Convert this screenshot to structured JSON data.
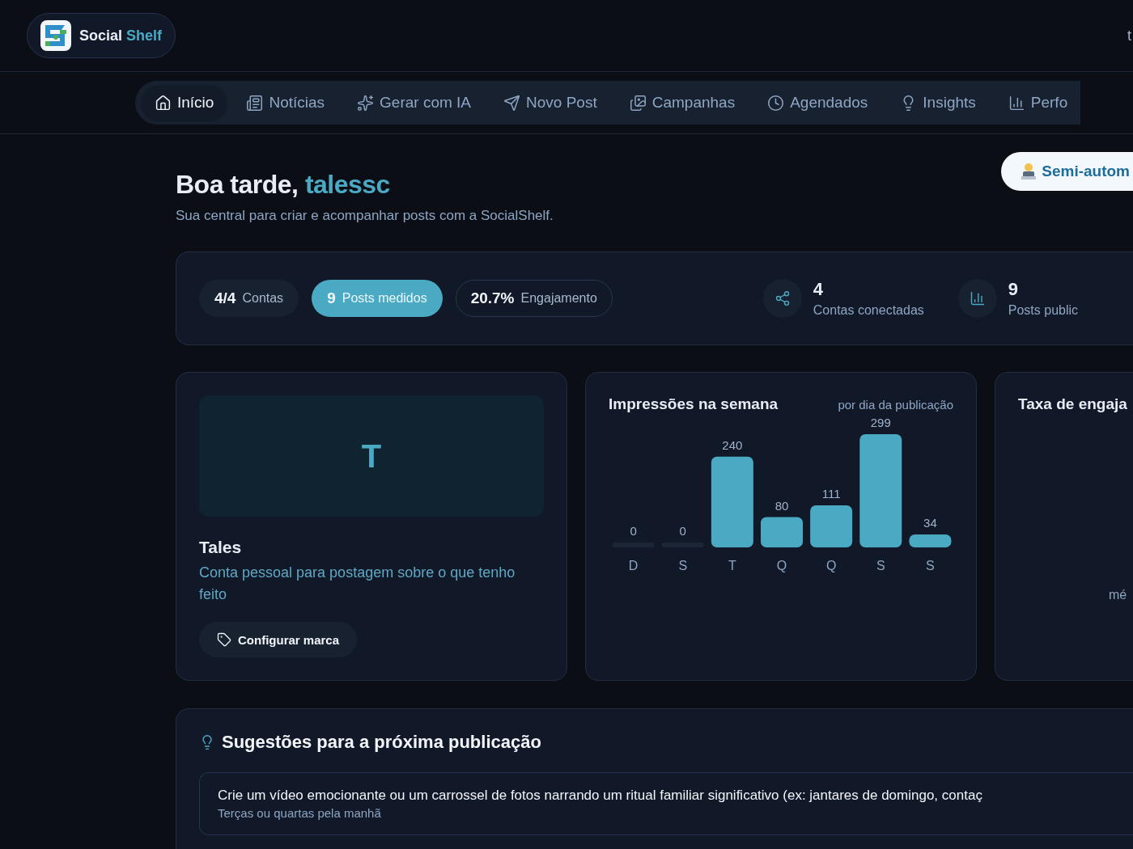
{
  "header": {
    "brand": {
      "first": "Social",
      "second": "Shelf"
    },
    "user_initial": "t"
  },
  "nav": [
    {
      "label": "Início",
      "selected": true
    },
    {
      "label": "Notícias",
      "selected": false
    },
    {
      "label": "Gerar com IA",
      "selected": false
    },
    {
      "label": "Novo Post",
      "selected": false
    },
    {
      "label": "Campanhas",
      "selected": false
    },
    {
      "label": "Agendados",
      "selected": false
    },
    {
      "label": "Insights",
      "selected": false
    },
    {
      "label": "Perfo",
      "selected": false
    }
  ],
  "greeting": {
    "prefix": "Boa tarde,",
    "name": "talessc",
    "subtitle": "Sua central para criar e acompanhar posts com a SocialShelf.",
    "mode_button": "Semi-autom"
  },
  "stats": {
    "chips": [
      {
        "value": "4/4",
        "label": "Contas",
        "selected": false,
        "kind": "filled"
      },
      {
        "value": "9",
        "label": "Posts medidos",
        "selected": true
      },
      {
        "value": "20.7%",
        "label": "Engajamento",
        "selected": false,
        "kind": "outline"
      }
    ],
    "metrics": [
      {
        "value": "4",
        "label": "Contas conectadas"
      },
      {
        "value": "9",
        "label": "Posts public"
      }
    ]
  },
  "account_card": {
    "initial": "T",
    "name": "Tales",
    "description": "Conta pessoal para postagem sobre o que tenho feito",
    "button": "Configurar marca"
  },
  "impressions_card": {
    "subtitle": "por dia da publicação",
    "chart_data": {
      "type": "bar",
      "title": "Impressões na semana",
      "categories": [
        "D",
        "S",
        "T",
        "Q",
        "Q",
        "S",
        "S"
      ],
      "values": [
        0,
        0,
        240,
        80,
        111,
        299,
        34
      ],
      "data_labels": true
    }
  },
  "engagement_card": {
    "title": "Taxa de engaja",
    "caption": "mé"
  },
  "suggestions": {
    "title": "Sugestões para a próxima publicação",
    "items": [
      {
        "text": "Crie um vídeo emocionante ou um carrossel de fotos narrando um ritual familiar significativo (ex: jantares de domingo, contaç",
        "hint": "Terças ou quartas pela manhã"
      }
    ]
  }
}
